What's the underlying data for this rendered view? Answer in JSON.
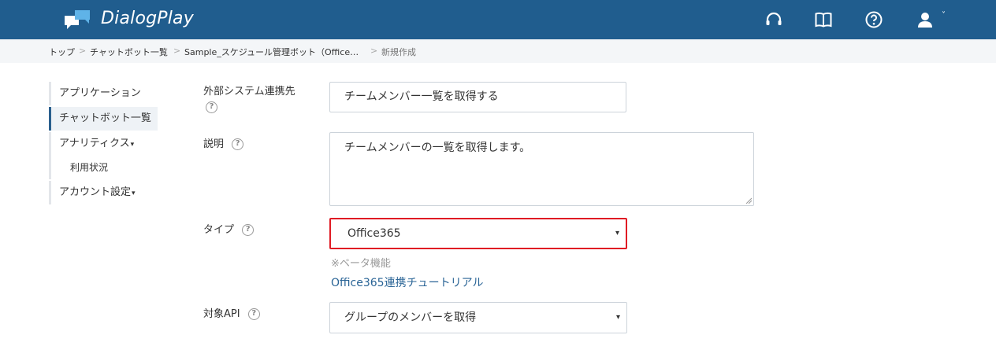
{
  "header": {
    "app_name": "DialogPlay",
    "icons": [
      "chat-bubbles-logo-icon",
      "headset-icon",
      "book-icon",
      "help-icon",
      "user-icon",
      "chevron-down-icon"
    ],
    "bg_color": "#205d8e"
  },
  "breadcrumb": {
    "items": [
      "トップ",
      "チャットボット一覧",
      "Sample_スケジュール管理ボット（Office…",
      "新規作成"
    ],
    "separator": ">"
  },
  "sidebar": {
    "items": [
      {
        "label": "アプリケーション"
      },
      {
        "label": "チャットボット一覧",
        "active": true
      },
      {
        "label": "アナリティクス",
        "caret": "▾"
      },
      {
        "label": "利用状況",
        "sub": true
      },
      {
        "label": "アカウント設定",
        "caret": "▾"
      }
    ]
  },
  "form": {
    "external_system": {
      "label": "外部システム連携先",
      "value": "チームメンバー一覧を取得する"
    },
    "description": {
      "label": "説明",
      "value": "チームメンバーの一覧を取得します。"
    },
    "type": {
      "label": "タイプ",
      "value": "Office365",
      "note": "※ベータ機能",
      "tutorial_link": "Office365連携チュートリアル",
      "highlight_color": "#e01b24"
    },
    "target_api": {
      "label": "対象API",
      "value": "グループのメンバーを取得"
    },
    "help_glyph": "?",
    "select_arrow": "▾"
  }
}
